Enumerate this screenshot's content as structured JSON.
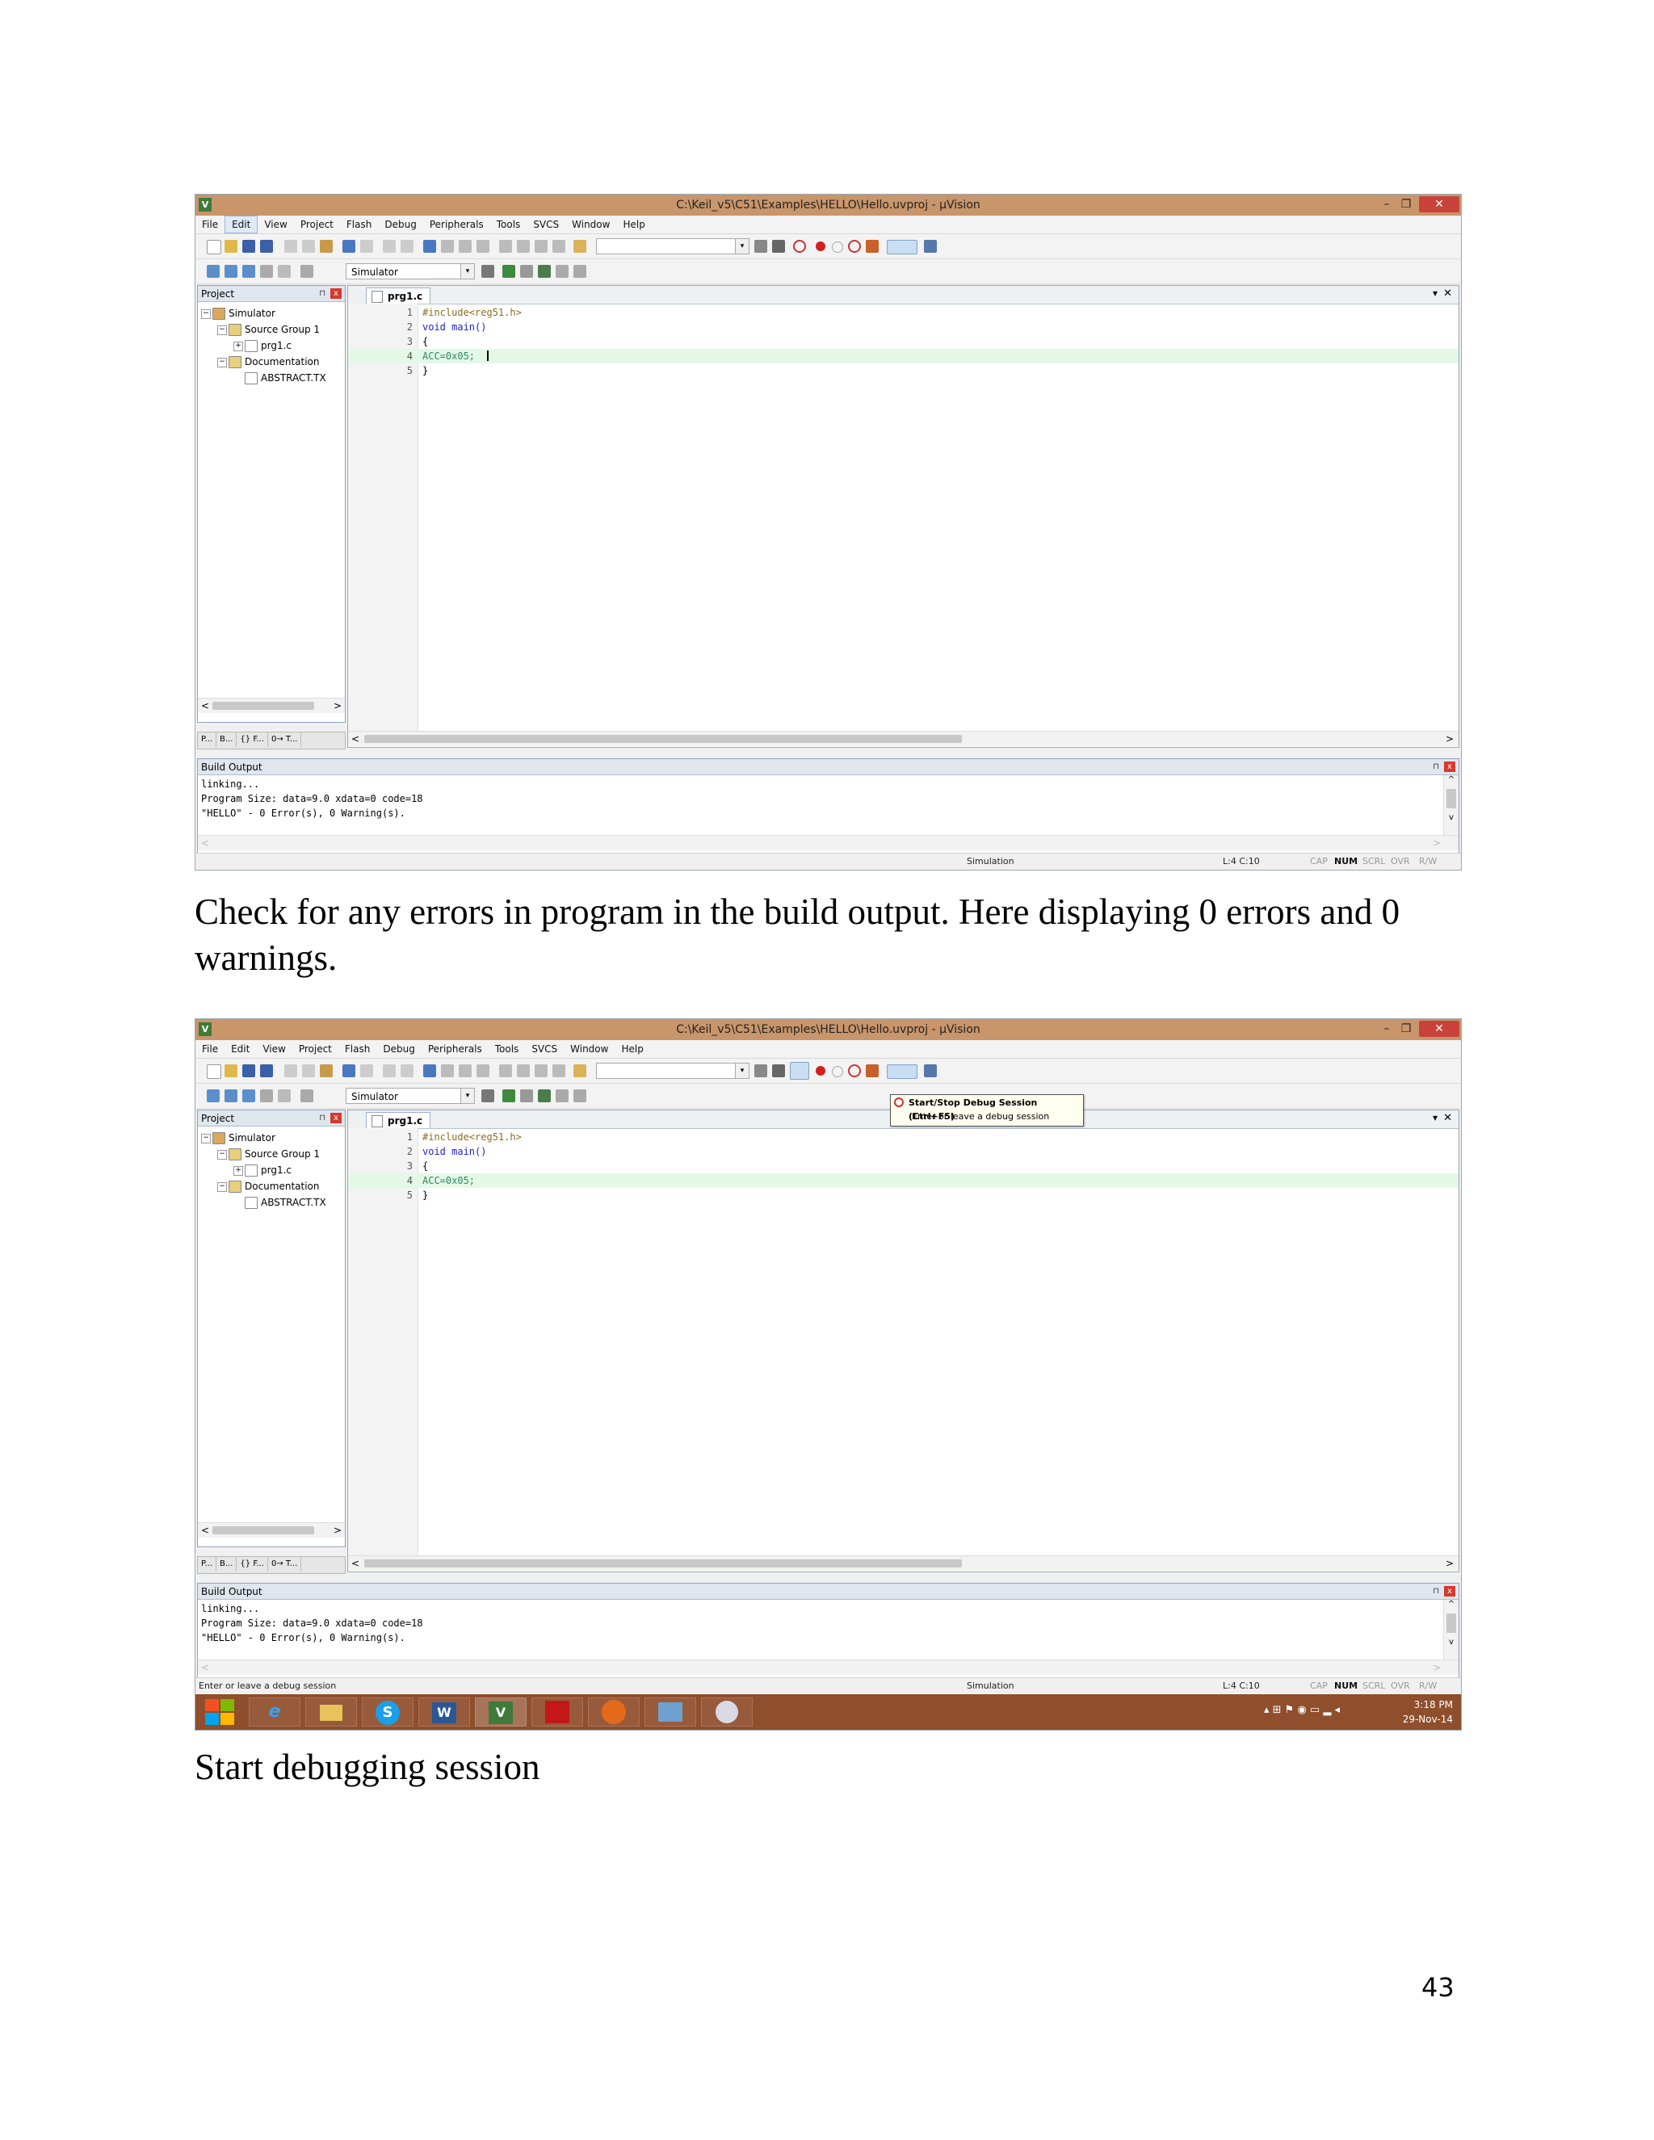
{
  "window": {
    "title": "C:\\Keil_v5\\C51\\Examples\\HELLO\\Hello.uvproj - µVision",
    "minimize": "–",
    "maximize": "❐",
    "close": "✕",
    "app_icon": "V"
  },
  "menu": [
    "File",
    "Edit",
    "View",
    "Project",
    "Flash",
    "Debug",
    "Peripherals",
    "Tools",
    "SVCS",
    "Window",
    "Help"
  ],
  "toolbar": {
    "target_select": "Simulator",
    "combo_arrow": "▾"
  },
  "project_panel": {
    "title": "Project",
    "pin": "⊓",
    "close": "x",
    "tree": {
      "root": "Simulator",
      "group": "Source Group 1",
      "file": "prg1.c",
      "docs": "Documentation",
      "doc_file": "ABSTRACT.TX"
    },
    "tabs": [
      "P...",
      "B...",
      "{} F...",
      "0→ T..."
    ],
    "scroll_left": "<",
    "scroll_right": ">"
  },
  "editor": {
    "tab": "prg1.c",
    "dropdown": "▾",
    "close": "✕",
    "scroll_left": "<",
    "scroll_right": ">",
    "lines": [
      {
        "n": "1",
        "text": "#include<reg51.h>"
      },
      {
        "n": "2",
        "text": "void main()"
      },
      {
        "n": "3",
        "text": "{"
      },
      {
        "n": "4",
        "text": "ACC=0x05;"
      },
      {
        "n": "5",
        "text": "}"
      }
    ]
  },
  "build_output": {
    "title": "Build Output",
    "pin": "⊓",
    "close": "x",
    "lines": [
      "linking...",
      "Program Size: data=9.0 xdata=0 code=18",
      "\"HELLO\" - 0 Error(s), 0 Warning(s)."
    ],
    "scroll_up": "^",
    "scroll_down": "v",
    "scroll_left": "<",
    "scroll_right": ">"
  },
  "status": {
    "left2": "Enter or leave a debug session",
    "mode": "Simulation",
    "position": "L:4 C:10",
    "cap": "CAP",
    "num": "NUM",
    "scrl": "SCRL",
    "ovr": "OVR",
    "rw": "R/W"
  },
  "tooltip": {
    "title": "Start/Stop Debug Session (Ctrl+F5)",
    "desc": "Enter or leave a debug session"
  },
  "taskbar": {
    "apps": [
      "e",
      "",
      "S",
      "W",
      "V",
      "",
      "",
      "",
      ""
    ],
    "time": "3:18 PM",
    "date": "29-Nov-14",
    "tray_icons": "▴ ⊞ ⚑ ◉ ▭ ▂ ◂"
  },
  "captions": {
    "first": "Check for any errors in program in the build output. Here displaying 0 errors and 0 warnings.",
    "second": "Start debugging session"
  },
  "page_number": "43",
  "colors": {
    "titlebar": "#c9956a",
    "close_button": "#c9423a",
    "highlight_line": "#e4f8e8",
    "taskbar": "#8f4e2c"
  }
}
